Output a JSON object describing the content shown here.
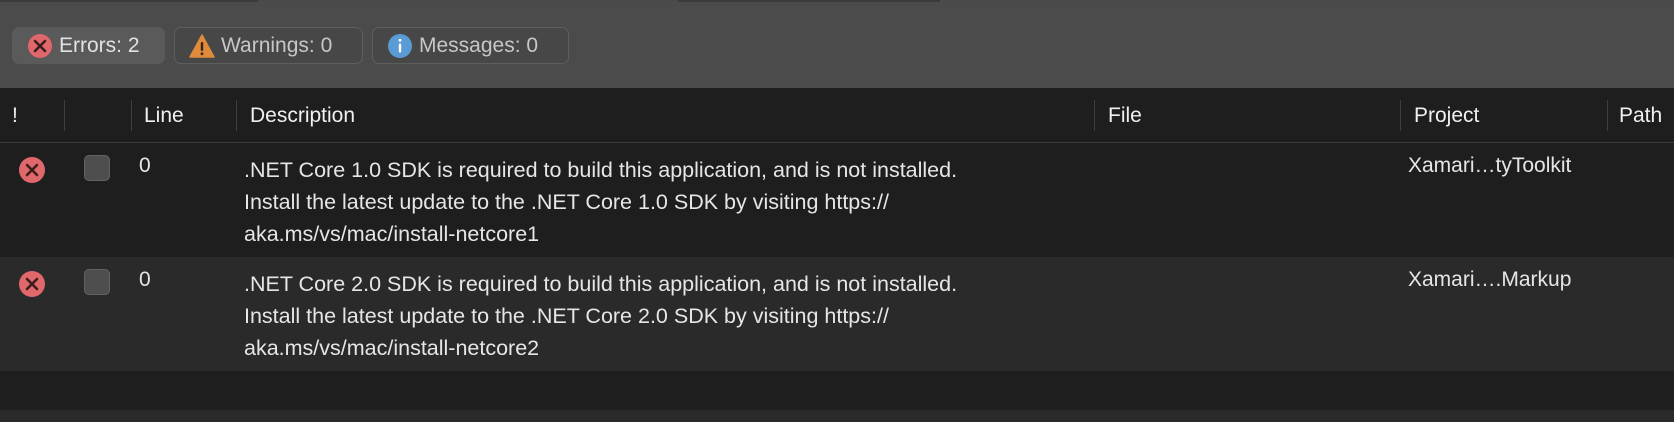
{
  "filters": {
    "errors_label": "Errors: 2",
    "warnings_label": "Warnings: 0",
    "messages_label": "Messages: 0"
  },
  "columns": {
    "severity": "!",
    "line": "Line",
    "description": "Description",
    "file": "File",
    "project": "Project",
    "path": "Path"
  },
  "rows": [
    {
      "line": "0",
      "description": [
        ".NET Core 1.0 SDK is required to build this application, and is not installed.",
        "Install the latest update to the .NET Core 1.0 SDK by visiting https://",
        "aka.ms/vs/mac/install-netcore1"
      ],
      "file": "",
      "project": "Xamari…tyToolkit",
      "path": ""
    },
    {
      "line": "0",
      "description": [
        ".NET Core 2.0 SDK is required to build this application, and is not installed.",
        "Install the latest update to the .NET Core 2.0 SDK by visiting https://",
        "aka.ms/vs/mac/install-netcore2"
      ],
      "file": "",
      "project": "Xamari….Markup",
      "path": ""
    }
  ],
  "colors": {
    "error": "#e0676b",
    "warning": "#e08a3c",
    "info": "#5b9bd5"
  }
}
